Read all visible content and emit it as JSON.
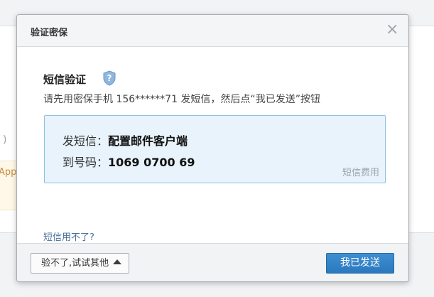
{
  "background": {
    "paren": ")",
    "app_text": "App"
  },
  "dialog": {
    "title": "验证密保",
    "close_glyph": "×",
    "section_title": "短信验证",
    "help_icon": "question-shield-icon",
    "instruction": "请先用密保手机 156******71 发短信，然后点“我已发送”按钮",
    "sms": {
      "content_label": "发短信：",
      "content_value": "配置邮件客户端",
      "number_label": "到号码：",
      "number_value": "1069 0700 69",
      "fee_link": "短信费用"
    },
    "cant_use_sms": "短信用不了?",
    "footer": {
      "try_other": "验不了,试试其他",
      "sent_button": "我已发送"
    }
  },
  "colors": {
    "primary_button": "#2b78bd",
    "sms_box_bg": "#e8f3fb",
    "sms_box_border": "#8fc0e2",
    "link": "#4a6f9a"
  }
}
